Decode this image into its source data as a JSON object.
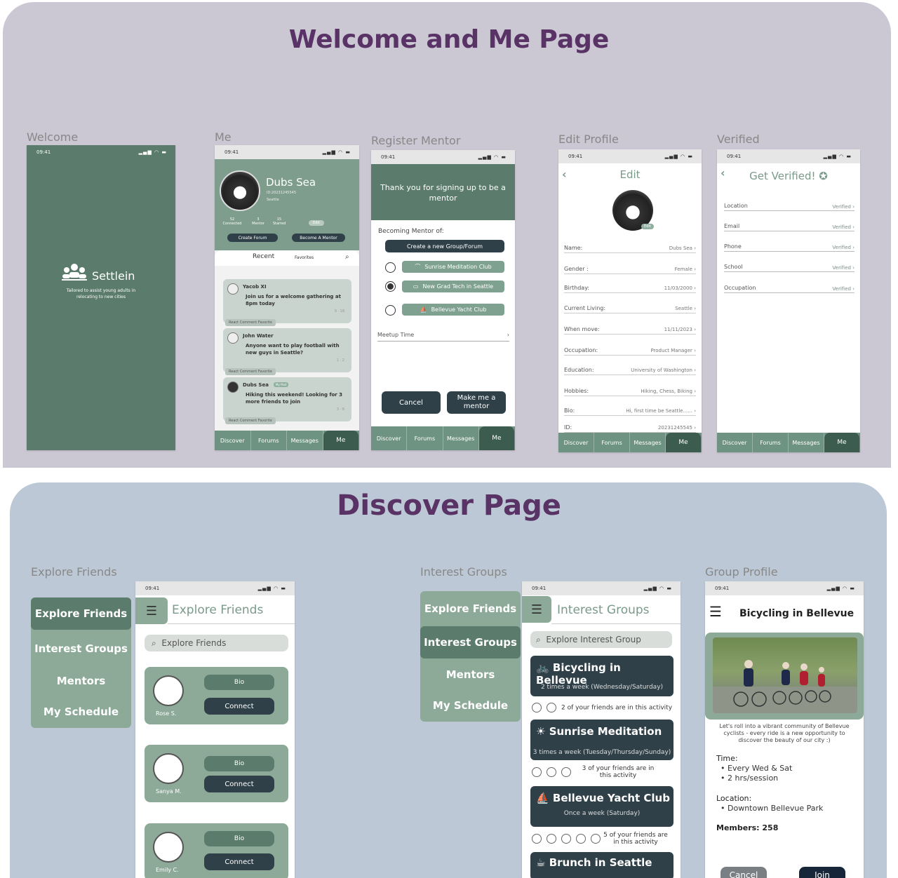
{
  "top": {
    "title": "Welcome and Me Page",
    "labels": {
      "welcome": "Welcome",
      "me": "Me",
      "register": "Register Mentor",
      "edit": "Edit Profile",
      "verified": "Verified"
    }
  },
  "status_time": "09:41",
  "nav": {
    "discover": "Discover",
    "forums": "Forums",
    "messages": "Messages",
    "me": "Me"
  },
  "welcome_screen": {
    "app": "Settlein",
    "tagline": "Tailored to assist young adults in relocating to new cities"
  },
  "me_screen": {
    "name": "Dubs Sea",
    "id": "ID:20231245545",
    "city": "Seattle",
    "stats": [
      {
        "num": "52",
        "label": "Connected"
      },
      {
        "num": "3",
        "label": "Mentor"
      },
      {
        "num": "15",
        "label": "Starred"
      }
    ],
    "edit": "Edit",
    "create_forum": "Create Forum",
    "become_mentor": "Become A Mentor",
    "tab_recent": "Recent",
    "tab_favorites": "Favorites",
    "actions": {
      "react": "React",
      "comment": "Comment",
      "favorite": "Favorite"
    },
    "my_post_badge": "My Post",
    "posts": [
      {
        "name": "Yacob XI",
        "text": "Join us for a welcome gathering at 8pm today",
        "counts": "9 · 18"
      },
      {
        "name": "John Water",
        "text": "Anyone want to play football with new guys in Seattle?",
        "counts": "1 · 2"
      },
      {
        "name": "Dubs Sea",
        "text": "Hiking this weekend! Looking for 3 more friends to join",
        "counts": "3 · 8"
      }
    ]
  },
  "register_screen": {
    "header": "Thank you for signing up to be a mentor",
    "becoming": "Becoming Mentor of:",
    "create_group": "Create a new Group/Forum",
    "clubs": [
      "Sunrise Meditation Club",
      "New Grad Tech in Seattle",
      "Bellevue Yacht Club"
    ],
    "meetup": "Meetup Time",
    "cancel": "Cancel",
    "make": "Make me a mentor"
  },
  "edit_screen": {
    "title": "Edit",
    "edit_badge": "Edit",
    "fields": [
      {
        "k": "Name:",
        "v": "Dubs Sea"
      },
      {
        "k": "Gender :",
        "v": "Female"
      },
      {
        "k": "Birthday:",
        "v": "11/03/2000"
      },
      {
        "k": "Current Living:",
        "v": "Seattle"
      },
      {
        "k": "When move:",
        "v": "11/11/2023"
      },
      {
        "k": "Occupation:",
        "v": "Product Manager"
      },
      {
        "k": "Education:",
        "v": "University of Washington"
      },
      {
        "k": "Hobbies:",
        "v": "Hiking, Chess, Biking"
      },
      {
        "k": "Bio:",
        "v": "Hi, first time be Seattle......"
      },
      {
        "k": "ID:",
        "v": "20231245545"
      }
    ]
  },
  "verified_screen": {
    "title": "Get Verified!",
    "fields": [
      {
        "k": "Location",
        "v": "Verified"
      },
      {
        "k": "Email",
        "v": "Verified"
      },
      {
        "k": "Phone",
        "v": "Verified"
      },
      {
        "k": "School",
        "v": "Verified"
      },
      {
        "k": "Occupation",
        "v": "Verified"
      }
    ]
  },
  "discover": {
    "title": "Discover Page",
    "labels": {
      "explore": "Explore Friends",
      "interest": "Interest Groups",
      "group": "Group Profile"
    },
    "side": [
      "Explore Friends",
      "Interest Groups",
      "Mentors",
      "My Schedule"
    ],
    "explore_screen": {
      "title": "Explore Friends",
      "search": "Explore Friends",
      "bio": "Bio",
      "connect": "Connect",
      "friends": [
        "Rose S.",
        "Sanya M.",
        "Emily C."
      ]
    },
    "interest_screen": {
      "title": "Interest Groups",
      "search": "Explore Interest Group",
      "groups": [
        {
          "name": "Bicycling in Bellevue",
          "freq": "2 times a week (Wednesday/Saturday)",
          "friends": "2 of your friends are in this activity"
        },
        {
          "name": "Sunrise Meditation",
          "freq": "3 times a week (Tuesday/Thursday/Sunday)",
          "friends": "3 of your friends are in this activity"
        },
        {
          "name": "Bellevue Yacht Club",
          "freq": "Once a week (Saturday)",
          "friends": "5 of your friends are in this activity"
        },
        {
          "name": "Brunch in Seattle",
          "freq": "",
          "friends": ""
        }
      ]
    },
    "group_screen": {
      "title": "Bicycling in Bellevue",
      "desc": "Let's roll into a vibrant community of Bellevue cyclists - every ride is a new opportunity to discover the beauty of our city :)",
      "time_label": "Time:",
      "time": [
        "Every Wed & Sat",
        "2 hrs/session"
      ],
      "loc_label": "Location:",
      "loc": [
        "Downtown Bellevue Park"
      ],
      "members": "Members: 258",
      "cancel": "Cancel",
      "join": "Join"
    }
  },
  "colors": {
    "top_panel": "#cbc7d3",
    "bottom_panel": "#bcc8d5",
    "title": "#5a3366",
    "green": "#5b7b6d",
    "dark": "#2f4049"
  }
}
